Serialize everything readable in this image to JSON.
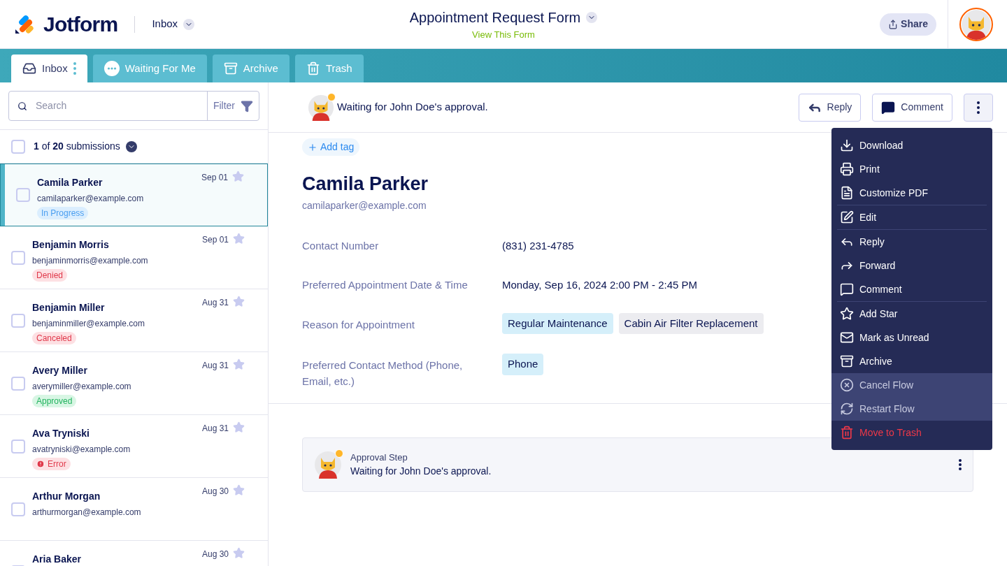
{
  "header": {
    "brand": "Jotform",
    "section": "Inbox",
    "form_title": "Appointment Request Form",
    "form_link": "View This Form",
    "share": "Share"
  },
  "tabs": [
    {
      "label": "Inbox",
      "selected": true
    },
    {
      "label": "Waiting For Me",
      "selected": false
    },
    {
      "label": "Archive",
      "selected": false
    },
    {
      "label": "Trash",
      "selected": false
    }
  ],
  "search": {
    "placeholder": "Search",
    "filter": "Filter"
  },
  "count": {
    "text": "**1** of **20** submissions",
    "checked": false
  },
  "submissions": [
    {
      "name": "Camila Parker",
      "email": "camilaparker@example.com",
      "date": "Sep 01",
      "status": {
        "label": "In Progress",
        "kind": "progress"
      },
      "selected": true
    },
    {
      "name": "Benjamin Morris",
      "email": "benjaminmorris@example.com",
      "date": "Sep 01",
      "status": {
        "label": "Denied",
        "kind": "denied"
      },
      "selected": false
    },
    {
      "name": "Benjamin Miller",
      "email": "benjaminmiller@example.com",
      "date": "Aug 31",
      "status": {
        "label": "Canceled",
        "kind": "denied"
      },
      "selected": false
    },
    {
      "name": "Avery Miller",
      "email": "averymiller@example.com",
      "date": "Aug 31",
      "status": {
        "label": "Approved",
        "kind": "approved"
      },
      "selected": false
    },
    {
      "name": "Ava Tryniski",
      "email": "avatryniski@example.com",
      "date": "Aug 31",
      "status": {
        "label": "Error",
        "kind": "error"
      },
      "selected": false
    },
    {
      "name": "Arthur Morgan",
      "email": "arthurmorgan@example.com",
      "date": "Aug 30",
      "selected": false
    },
    {
      "name": "Aria Baker",
      "date": "Aug 30",
      "selected": false
    }
  ],
  "detail": {
    "waiting": "Waiting for John Doe's approval.",
    "actions": [
      "Reply",
      "Comment"
    ],
    "add_tag": "Add tag",
    "name": "Camila Parker",
    "email": "camilaparker@example.com",
    "fields": [
      {
        "label": "Contact Number",
        "values": [
          {
            "text": "(831) 231-4785",
            "kind": "plain"
          }
        ]
      },
      {
        "label": "Preferred Appointment Date & Time",
        "values": [
          {
            "text": "Monday, Sep 16, 2024 2:00 PM - 2:45 PM",
            "kind": "plain"
          }
        ]
      },
      {
        "label": "Reason for Appointment",
        "values": [
          {
            "text": "Regular Maintenance",
            "kind": "blue"
          },
          {
            "text": "Cabin Air Filter Replacement",
            "kind": "gray"
          }
        ]
      },
      {
        "label": "Preferred Contact Method (Phone, Email, etc.)",
        "values": [
          {
            "text": "Phone",
            "kind": "blue"
          }
        ]
      }
    ],
    "approval": {
      "step": "Approval Step",
      "text": "Waiting for John Doe's approval."
    }
  },
  "menu": [
    {
      "label": "Download",
      "kind": "normal",
      "divider_after": false
    },
    {
      "label": "Print",
      "kind": "normal",
      "divider_after": false
    },
    {
      "label": "Customize PDF",
      "kind": "normal",
      "divider_after": true
    },
    {
      "label": "Edit",
      "kind": "normal",
      "divider_after": true
    },
    {
      "label": "Reply",
      "kind": "normal",
      "divider_after": false
    },
    {
      "label": "Forward",
      "kind": "normal",
      "divider_after": false
    },
    {
      "label": "Comment",
      "kind": "normal",
      "divider_after": true
    },
    {
      "label": "Add Star",
      "kind": "normal",
      "divider_after": false
    },
    {
      "label": "Mark as Unread",
      "kind": "normal",
      "divider_after": false
    },
    {
      "label": "Archive",
      "kind": "normal",
      "divider_after": false
    },
    {
      "label": "Cancel Flow",
      "kind": "muted",
      "divider_after": false
    },
    {
      "label": "Restart Flow",
      "kind": "muted",
      "divider_after": false
    },
    {
      "label": "Move to Trash",
      "kind": "danger",
      "divider_after": false
    }
  ]
}
